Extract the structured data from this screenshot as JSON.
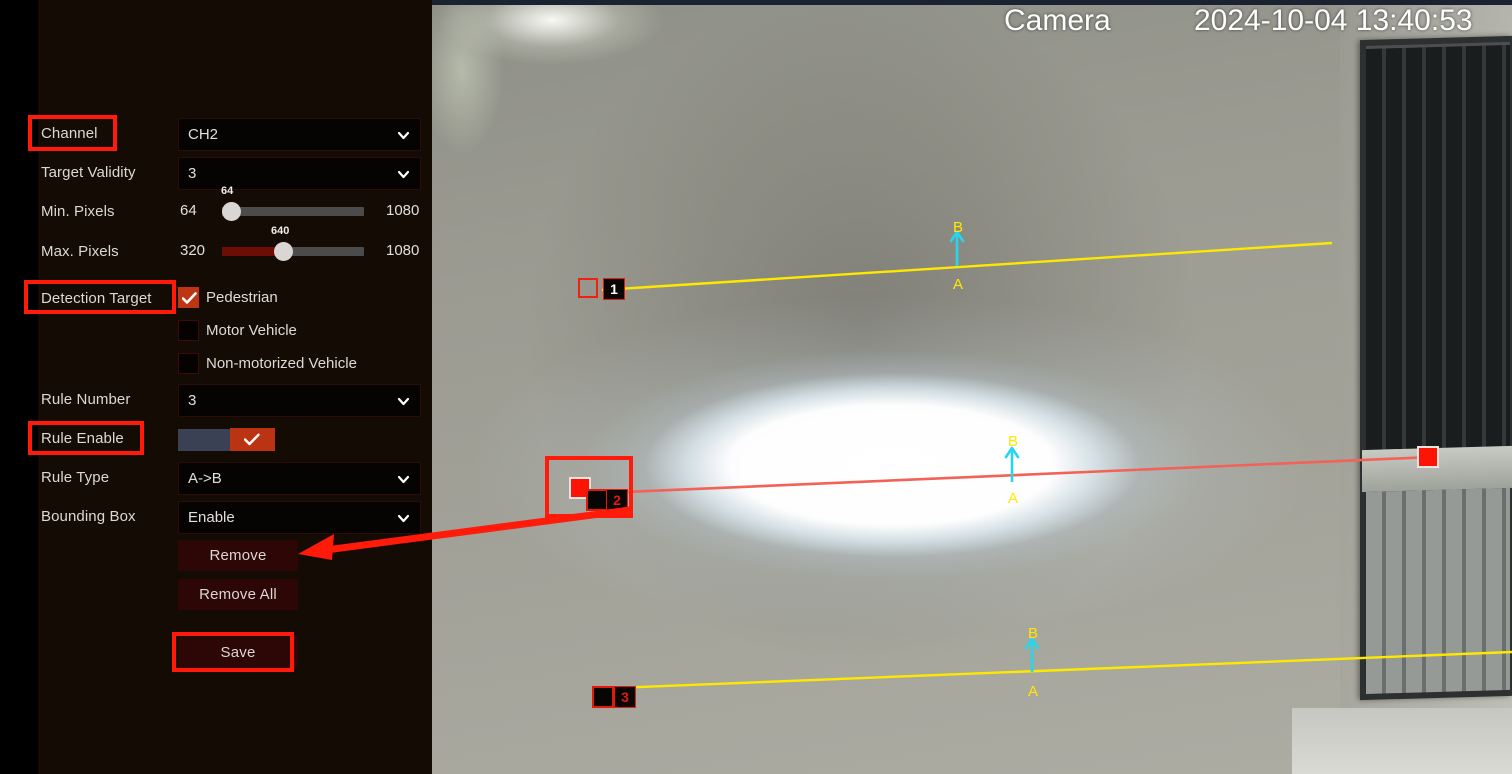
{
  "panel": {
    "rows": [
      {
        "label": "Channel",
        "type": "select",
        "value": "CH2"
      },
      {
        "label": "Target Validity",
        "type": "select",
        "value": "3"
      },
      {
        "label": "Min. Pixels",
        "type": "slider",
        "min": "64",
        "max": "1080",
        "thumb": "64"
      },
      {
        "label": "Max. Pixels",
        "type": "slider",
        "min": "320",
        "max": "1080",
        "thumb": "640"
      },
      {
        "label": "Detection Target",
        "type": "checkbox"
      },
      {
        "label": "Rule Number",
        "type": "select",
        "value": "3"
      },
      {
        "label": "Rule Enable",
        "type": "toggle",
        "value": "on"
      },
      {
        "label": "Rule Type",
        "type": "select",
        "value": "A->B"
      },
      {
        "label": "Bounding Box",
        "type": "select",
        "value": "Enable"
      }
    ],
    "detection_targets": [
      {
        "label": "Pedestrian",
        "checked": true
      },
      {
        "label": "Motor Vehicle",
        "checked": false
      },
      {
        "label": "Non-motorized Vehicle",
        "checked": false
      }
    ],
    "buttons": {
      "remove": "Remove",
      "remove_all": "Remove All",
      "save": "Save"
    },
    "colors": {
      "panel_bg": "#140b05",
      "field_bg": "#060303",
      "button_bg": "#2d0606",
      "accent_red": "#bd3514",
      "annotation_red": "#ff1a09",
      "toggle_track": "#3b4155"
    }
  },
  "annotations": {
    "highlighted_labels": [
      "Channel",
      "Detection Target",
      "Rule Enable"
    ],
    "highlighted_buttons": [
      "Save"
    ],
    "arrow_target": "Remove",
    "highlighted_video_region": "rule-line-2-start-handle"
  },
  "video": {
    "osd_title": "Camera",
    "osd_timestamp": "2024-10-04 13:40:53",
    "rule_lines": [
      {
        "number": "1",
        "color": "#ffe800",
        "selected": false,
        "direction_from": "A",
        "direction_to": "B"
      },
      {
        "number": "2",
        "color": "#f26257",
        "selected": true,
        "direction_from": "A",
        "direction_to": "B"
      },
      {
        "number": "3",
        "color": "#ffe800",
        "selected": false,
        "direction_from": "A",
        "direction_to": "B"
      }
    ],
    "direction_arrow_color": "#25d6ee",
    "label_a": "A",
    "label_b": "B"
  }
}
